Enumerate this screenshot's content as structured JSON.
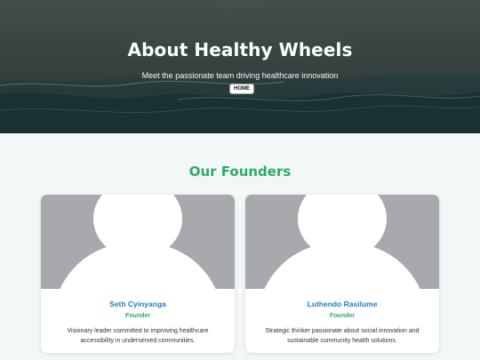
{
  "hero": {
    "title": "About Healthy Wheels",
    "subtitle": "Meet the passionate team driving healthcare innovation",
    "home_button": "HOME"
  },
  "founders_section": {
    "title": "Our Founders",
    "cards": [
      {
        "name": "Seth Cyinyanga",
        "role": "Founder",
        "description": "Visionary leader committed to improving healthcare accessibility in underserved communities."
      },
      {
        "name": "Luthendo Rasilume",
        "role": "Founder",
        "description": "Strategic thinker passionate about social innovation and sustainable community health solutions."
      }
    ]
  },
  "colors": {
    "accent_green": "#2daa6a",
    "name_blue": "#2579c8",
    "avatar_gray": "#a8a9ad"
  },
  "icons": {
    "avatar": "person-silhouette-icon"
  }
}
